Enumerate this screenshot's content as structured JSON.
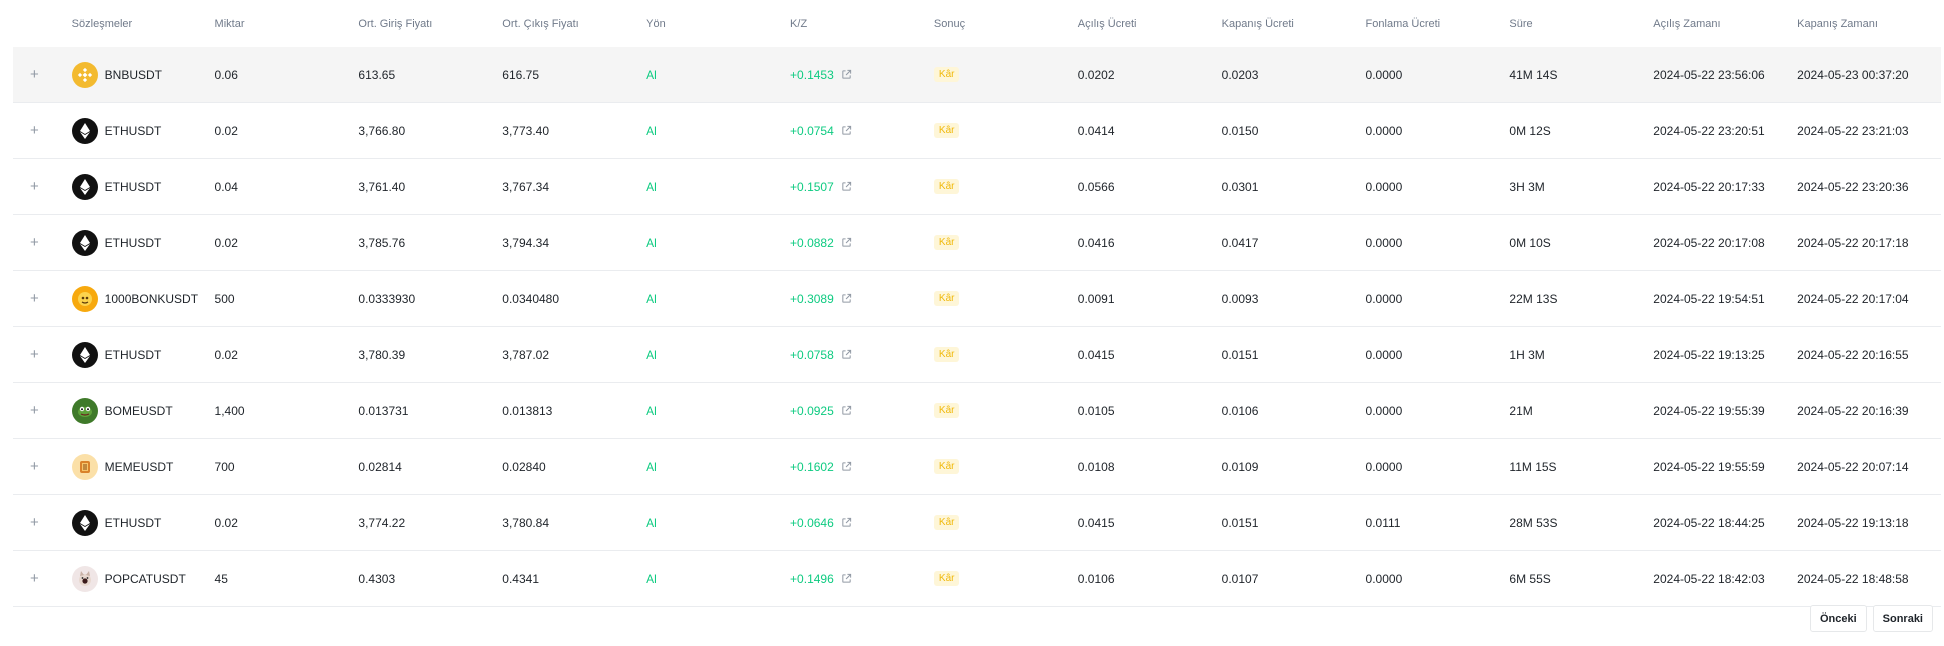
{
  "headers": {
    "contract": "Sözleşmeler",
    "quantity": "Miktar",
    "avg_entry": "Ort. Giriş Fiyatı",
    "avg_exit": "Ort. Çıkış Fiyatı",
    "direction": "Yön",
    "pnl": "K/Z",
    "result": "Sonuç",
    "open_fee": "Açılış Ücreti",
    "close_fee": "Kapanış Ücreti",
    "funding_fee": "Fonlama Ücreti",
    "duration": "Süre",
    "open_time": "Açılış Zamanı",
    "close_time": "Kapanış Zamanı"
  },
  "expand_glyph": "+",
  "rows": [
    {
      "symbol": "BNBUSDT",
      "icon": "bnb-coin-icon",
      "qty": "0.06",
      "entry": "613.65",
      "exit": "616.75",
      "dir": "Al",
      "pnl": "+0.1453",
      "result": "Kâr",
      "open_fee": "0.0202",
      "close_fee": "0.0203",
      "funding_fee": "0.0000",
      "duration": "41M 14S",
      "open_time": "2024-05-22 23:56:06",
      "close_time": "2024-05-23 00:37:20"
    },
    {
      "symbol": "ETHUSDT",
      "icon": "eth-coin-icon",
      "qty": "0.02",
      "entry": "3,766.80",
      "exit": "3,773.40",
      "dir": "Al",
      "pnl": "+0.0754",
      "result": "Kâr",
      "open_fee": "0.0414",
      "close_fee": "0.0150",
      "funding_fee": "0.0000",
      "duration": "0M 12S",
      "open_time": "2024-05-22 23:20:51",
      "close_time": "2024-05-22 23:21:03"
    },
    {
      "symbol": "ETHUSDT",
      "icon": "eth-coin-icon",
      "qty": "0.04",
      "entry": "3,761.40",
      "exit": "3,767.34",
      "dir": "Al",
      "pnl": "+0.1507",
      "result": "Kâr",
      "open_fee": "0.0566",
      "close_fee": "0.0301",
      "funding_fee": "0.0000",
      "duration": "3H 3M",
      "open_time": "2024-05-22 20:17:33",
      "close_time": "2024-05-22 23:20:36"
    },
    {
      "symbol": "ETHUSDT",
      "icon": "eth-coin-icon",
      "qty": "0.02",
      "entry": "3,785.76",
      "exit": "3,794.34",
      "dir": "Al",
      "pnl": "+0.0882",
      "result": "Kâr",
      "open_fee": "0.0416",
      "close_fee": "0.0417",
      "funding_fee": "0.0000",
      "duration": "0M 10S",
      "open_time": "2024-05-22 20:17:08",
      "close_time": "2024-05-22 20:17:18"
    },
    {
      "symbol": "1000BONKUSDT",
      "icon": "bonk-coin-icon",
      "qty": "500",
      "entry": "0.0333930",
      "exit": "0.0340480",
      "dir": "Al",
      "pnl": "+0.3089",
      "result": "Kâr",
      "open_fee": "0.0091",
      "close_fee": "0.0093",
      "funding_fee": "0.0000",
      "duration": "22M 13S",
      "open_time": "2024-05-22 19:54:51",
      "close_time": "2024-05-22 20:17:04"
    },
    {
      "symbol": "ETHUSDT",
      "icon": "eth-coin-icon",
      "qty": "0.02",
      "entry": "3,780.39",
      "exit": "3,787.02",
      "dir": "Al",
      "pnl": "+0.0758",
      "result": "Kâr",
      "open_fee": "0.0415",
      "close_fee": "0.0151",
      "funding_fee": "0.0000",
      "duration": "1H 3M",
      "open_time": "2024-05-22 19:13:25",
      "close_time": "2024-05-22 20:16:55"
    },
    {
      "symbol": "BOMEUSDT",
      "icon": "bome-coin-icon",
      "qty": "1,400",
      "entry": "0.013731",
      "exit": "0.013813",
      "dir": "Al",
      "pnl": "+0.0925",
      "result": "Kâr",
      "open_fee": "0.0105",
      "close_fee": "0.0106",
      "funding_fee": "0.0000",
      "duration": "21M",
      "open_time": "2024-05-22 19:55:39",
      "close_time": "2024-05-22 20:16:39"
    },
    {
      "symbol": "MEMEUSDT",
      "icon": "meme-coin-icon",
      "qty": "700",
      "entry": "0.02814",
      "exit": "0.02840",
      "dir": "Al",
      "pnl": "+0.1602",
      "result": "Kâr",
      "open_fee": "0.0108",
      "close_fee": "0.0109",
      "funding_fee": "0.0000",
      "duration": "11M 15S",
      "open_time": "2024-05-22 19:55:59",
      "close_time": "2024-05-22 20:07:14"
    },
    {
      "symbol": "ETHUSDT",
      "icon": "eth-coin-icon",
      "qty": "0.02",
      "entry": "3,774.22",
      "exit": "3,780.84",
      "dir": "Al",
      "pnl": "+0.0646",
      "result": "Kâr",
      "open_fee": "0.0415",
      "close_fee": "0.0151",
      "funding_fee": "0.0111",
      "duration": "28M 53S",
      "open_time": "2024-05-22 18:44:25",
      "close_time": "2024-05-22 19:13:18"
    },
    {
      "symbol": "POPCATUSDT",
      "icon": "popcat-coin-icon",
      "qty": "45",
      "entry": "0.4303",
      "exit": "0.4341",
      "dir": "Al",
      "pnl": "+0.1496",
      "result": "Kâr",
      "open_fee": "0.0106",
      "close_fee": "0.0107",
      "funding_fee": "0.0000",
      "duration": "6M 55S",
      "open_time": "2024-05-22 18:42:03",
      "close_time": "2024-05-22 18:48:58"
    }
  ],
  "pagination": {
    "prev": "Önceki",
    "next": "Sonraki"
  },
  "colors": {
    "profit_green": "#0ecb81",
    "badge_bg": "#fef6d8",
    "badge_text": "#f0b90b",
    "header_text": "#707a8a",
    "border": "#eaecef"
  }
}
